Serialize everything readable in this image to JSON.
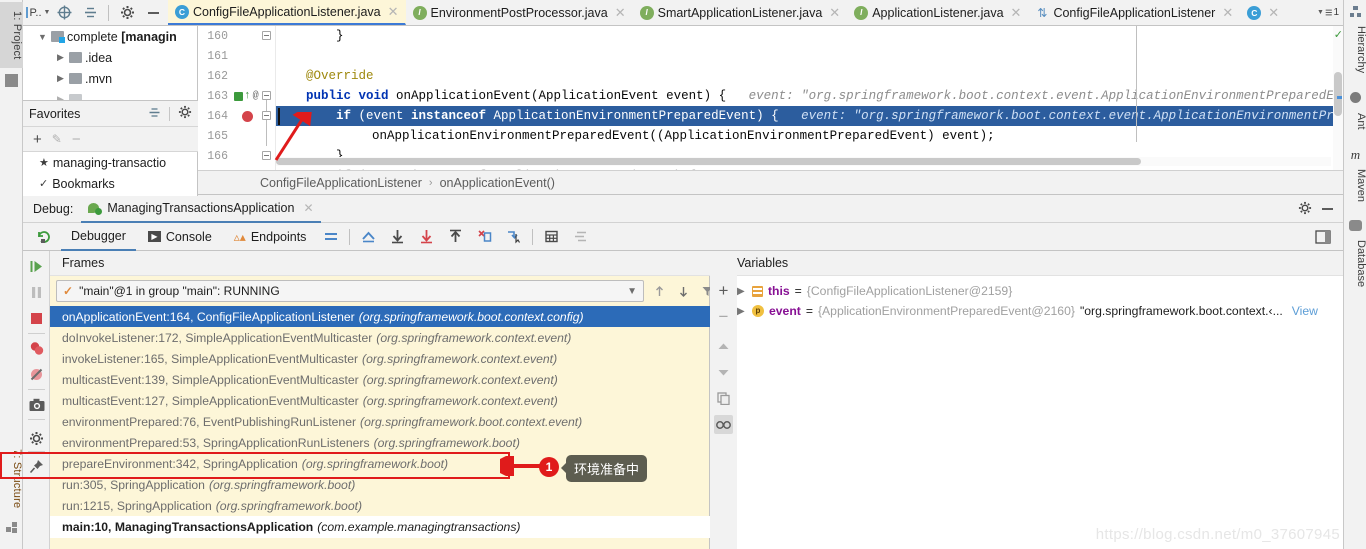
{
  "window": {
    "left_rail": [
      {
        "label": "1: Project",
        "name": "project-tool-tab"
      },
      {
        "label": "7: Structure",
        "name": "structure-tool-tab"
      }
    ],
    "right_rail": [
      {
        "label": "Hierarchy",
        "icon": "hierarchy-icon"
      },
      {
        "label": "Ant",
        "icon": "ant-icon"
      },
      {
        "label": "Maven",
        "icon": "maven-icon"
      },
      {
        "label": "Database",
        "icon": "database-icon"
      }
    ]
  },
  "toolbar": {
    "project_selector": "P..",
    "locate_icon": "crosshair-icon",
    "collapse_icon": "collapse-all-icon",
    "settings_icon": "gear-icon",
    "hide_icon": "hide-icon"
  },
  "tabs": [
    {
      "label": "ConfigFileApplicationListener.java",
      "icon": "java-class-icon",
      "active": true
    },
    {
      "label": "EnvironmentPostProcessor.java",
      "icon": "java-interface-icon",
      "active": false
    },
    {
      "label": "SmartApplicationListener.java",
      "icon": "java-interface-icon",
      "active": false
    },
    {
      "label": "ApplicationListener.java",
      "icon": "java-interface-icon",
      "active": false
    },
    {
      "label": "ConfigFileApplicationListener",
      "icon": "structure-icon",
      "active": false
    },
    {
      "label": "",
      "icon": "java-class-blue-icon",
      "active": false
    }
  ],
  "tab_overflow": "1",
  "project": {
    "tree": [
      {
        "label": "complete [managin",
        "bold_from": "complete ",
        "depth": 0,
        "expanded": true,
        "icon": "module-folder-icon"
      },
      {
        "label": ".idea",
        "depth": 1,
        "expanded": false,
        "icon": "folder-icon"
      },
      {
        "label": ".mvn",
        "depth": 1,
        "expanded": false,
        "icon": "folder-icon"
      }
    ]
  },
  "favorites": {
    "title": "Favorites",
    "actions": [
      "add-icon",
      "edit-icon",
      "remove-icon"
    ],
    "items": [
      {
        "label": "managing-transactio",
        "icon": "star-icon"
      },
      {
        "label": "Bookmarks",
        "icon": "check-icon"
      }
    ]
  },
  "editor": {
    "lines": [
      {
        "num": "160",
        "fold": true,
        "indent": 2,
        "segments": [
          {
            "t": "}",
            "c": "plain"
          }
        ]
      },
      {
        "num": "161",
        "segments": []
      },
      {
        "num": "162",
        "indent": 1,
        "segments": [
          {
            "t": "@Override",
            "c": "anno"
          }
        ]
      },
      {
        "num": "163",
        "fold": true,
        "indent": 1,
        "marker": "bookmark",
        "at": "@",
        "segments": [
          {
            "t": "public",
            "c": "kw"
          },
          {
            "t": " ",
            "c": "plain"
          },
          {
            "t": "void",
            "c": "kw"
          },
          {
            "t": " ",
            "c": "plain"
          },
          {
            "t": "onApplicationEvent(ApplicationEvent event) {",
            "c": "plain"
          },
          {
            "t": "   event: \"org.springframework.boot.context.event.ApplicationEnvironmentPreparedEvent[source=org.",
            "c": "hint"
          }
        ]
      },
      {
        "num": "164",
        "fold": true,
        "indent": 2,
        "highlight": true,
        "marker": "breakpoint",
        "segments": [
          {
            "t": "if",
            "c": "kw"
          },
          {
            "t": " (event ",
            "c": "plain"
          },
          {
            "t": "instanceof",
            "c": "kw"
          },
          {
            "t": " ApplicationEnvironmentPreparedEvent) {",
            "c": "plain"
          },
          {
            "t": "   event: \"org.springframework.boot.context.event.ApplicationEnvironmentPreparedEvent[sour",
            "c": "hint"
          }
        ]
      },
      {
        "num": "165",
        "indent": 3,
        "segments": [
          {
            "t": "onApplicationEnvironmentPreparedEvent((ApplicationEnvironmentPreparedEvent) event);",
            "c": "plain"
          }
        ]
      },
      {
        "num": "166",
        "fold": true,
        "indent": 2,
        "segments": [
          {
            "t": "}",
            "c": "plain"
          }
        ]
      },
      {
        "num": "167",
        "fold": true,
        "indent": 2,
        "segments": [
          {
            "t": "if (event instanceof ApplicationPreparedEvent) {",
            "c": "plain"
          }
        ]
      }
    ]
  },
  "breadcrumb": {
    "items": [
      "ConfigFileApplicationListener",
      "onApplicationEvent()"
    ],
    "separator": "›"
  },
  "debug": {
    "label": "Debug:",
    "session": "ManagingTransactionsApplication",
    "session_icon": "spring-run-icon",
    "close_icon": "close-icon",
    "settings_icon": "gear-icon",
    "minimize_icon": "minimize-icon",
    "rerun_icon": "rerun-icon",
    "tabs": [
      {
        "label": "Debugger",
        "icon": "",
        "active": true
      },
      {
        "label": "Console",
        "icon": "console-icon",
        "active": false
      },
      {
        "label": "Endpoints",
        "icon": "endpoints-icon",
        "active": false
      }
    ],
    "step_buttons": [
      "layout-icon",
      "show-execution-point-icon",
      "step-over-icon",
      "step-into-icon",
      "force-step-into-icon",
      "step-out-icon",
      "drop-frame-icon",
      "run-to-cursor-icon",
      "evaluate-icon",
      "settings-list-icon"
    ],
    "side_buttons": [
      "resume-program-icon",
      "pause-program-icon",
      "stop-icon",
      "view-breakpoints-icon",
      "mute-breakpoints-icon",
      "screenshot-icon",
      "settings-icon",
      "pin-icon"
    ],
    "restore_layout_icon": "restore-layout-icon"
  },
  "frames": {
    "title": "Frames",
    "thread": "\"main\"@1 in group \"main\": RUNNING",
    "thread_icon": "check-icon",
    "arrows": [
      "arrow-up-icon",
      "arrow-down-icon",
      "filter-icon"
    ],
    "items": [
      {
        "method": "onApplicationEvent:164, ConfigFileApplicationListener",
        "pkg": "(org.springframework.boot.context.config)",
        "selected": true
      },
      {
        "method": "doInvokeListener:172, SimpleApplicationEventMulticaster",
        "pkg": "(org.springframework.context.event)"
      },
      {
        "method": "invokeListener:165, SimpleApplicationEventMulticaster",
        "pkg": "(org.springframework.context.event)"
      },
      {
        "method": "multicastEvent:139, SimpleApplicationEventMulticaster",
        "pkg": "(org.springframework.context.event)"
      },
      {
        "method": "multicastEvent:127, SimpleApplicationEventMulticaster",
        "pkg": "(org.springframework.context.event)"
      },
      {
        "method": "environmentPrepared:76, EventPublishingRunListener",
        "pkg": "(org.springframework.boot.context.event)"
      },
      {
        "method": "environmentPrepared:53, SpringApplicationRunListeners",
        "pkg": "(org.springframework.boot)"
      },
      {
        "method": "prepareEnvironment:342, SpringApplication",
        "pkg": "(org.springframework.boot)",
        "annotated": true
      },
      {
        "method": "run:305, SpringApplication",
        "pkg": "(org.springframework.boot)"
      },
      {
        "method": "run:1215, SpringApplication",
        "pkg": "(org.springframework.boot)"
      },
      {
        "method": "main:10, ManagingTransactionsApplication",
        "pkg": "(com.example.managingtransactions)",
        "bold": true
      }
    ]
  },
  "variables": {
    "title": "Variables",
    "toolbar": [
      "add-icon",
      "remove-icon",
      "move-up-icon",
      "move-down-icon",
      "copy-icon",
      "watches-icon"
    ],
    "rows": [
      {
        "icon": "field-icon",
        "name": "this",
        "eq": " = ",
        "value": "{ConfigFileApplicationListener@2159}",
        "string": "",
        "view": ""
      },
      {
        "icon": "param-icon",
        "name": "event",
        "eq": " = ",
        "value": "{ApplicationEnvironmentPreparedEvent@2160}",
        "string": "\"org.springframework.boot.context.‹...",
        "view": "View"
      }
    ]
  },
  "annotation": {
    "badge": "1",
    "tooltip": "环境准备中"
  },
  "watermark": "https://blog.csdn.net/m0_37607945",
  "colors": {
    "accent_blue": "#2c6bb8",
    "highlight_line": "#2c5d9e",
    "panel_yellow": "#fdf6d8",
    "annotation_red": "#e01b1b",
    "tooltip_bg": "#5d5d50"
  }
}
